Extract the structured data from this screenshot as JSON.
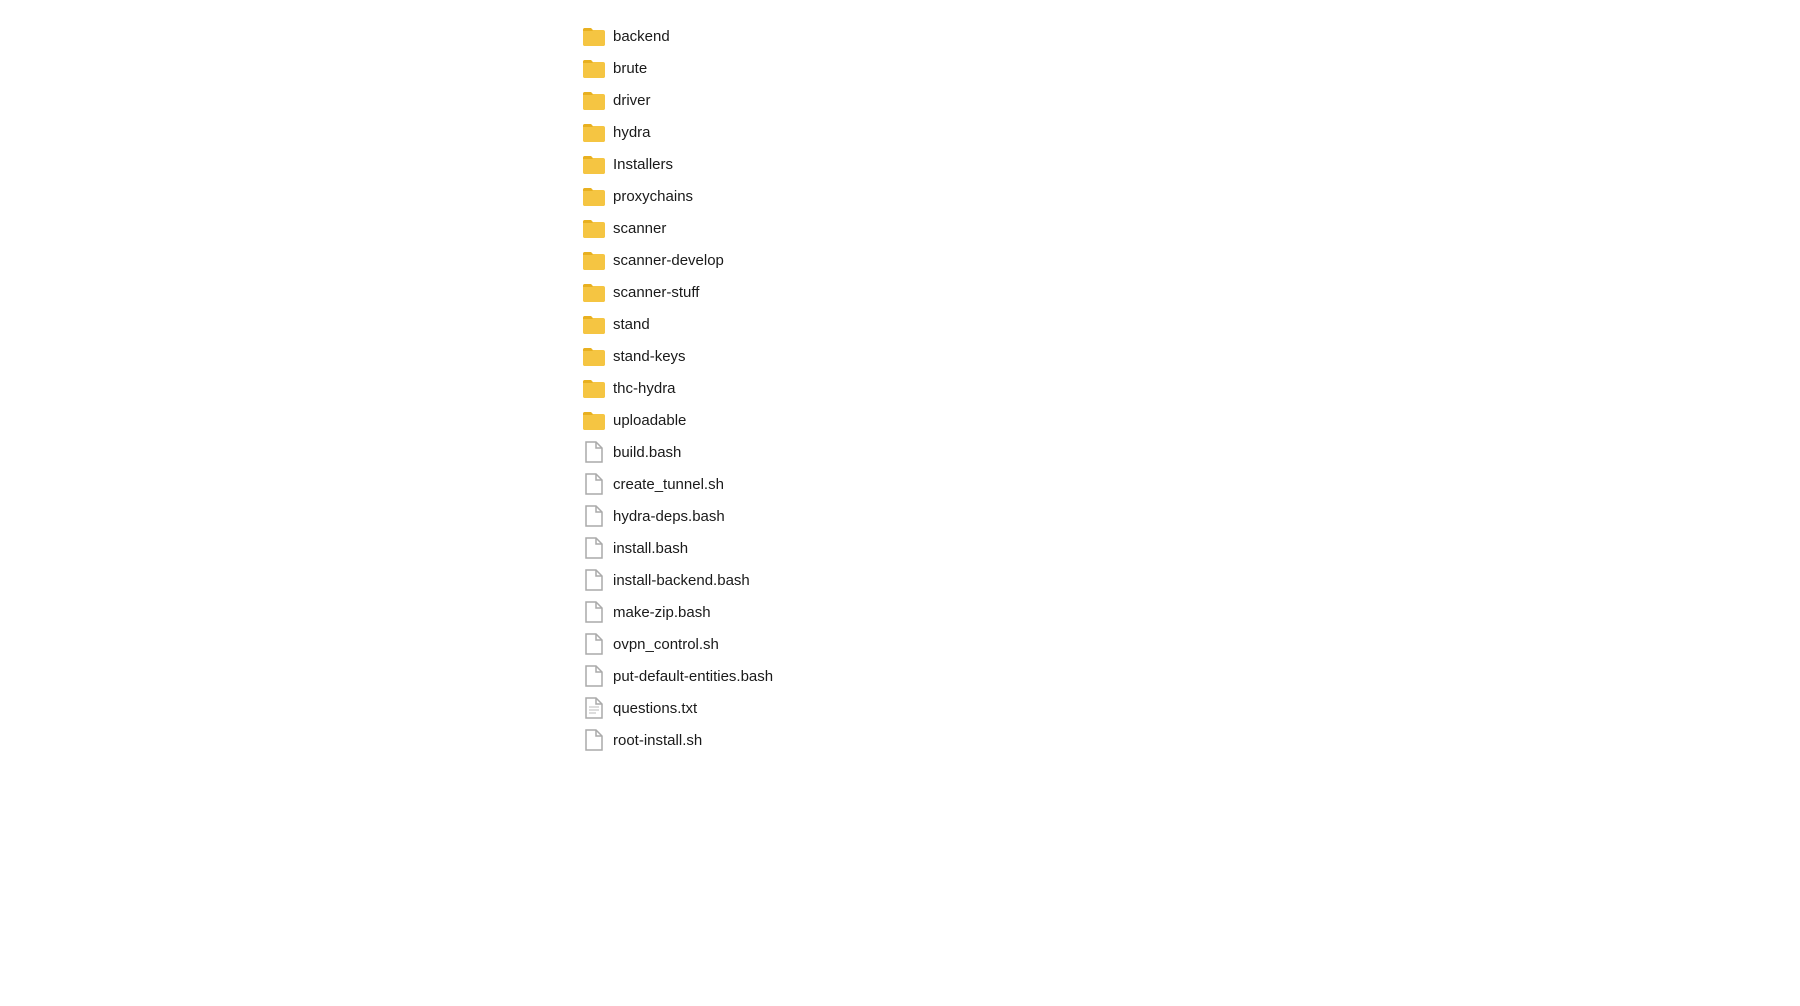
{
  "fileList": {
    "items": [
      {
        "id": "backend",
        "name": "backend",
        "type": "folder"
      },
      {
        "id": "brute",
        "name": "brute",
        "type": "folder"
      },
      {
        "id": "driver",
        "name": "driver",
        "type": "folder"
      },
      {
        "id": "hydra",
        "name": "hydra",
        "type": "folder"
      },
      {
        "id": "Installers",
        "name": "Installers",
        "type": "folder"
      },
      {
        "id": "proxychains",
        "name": "proxychains",
        "type": "folder"
      },
      {
        "id": "scanner",
        "name": "scanner",
        "type": "folder"
      },
      {
        "id": "scanner-develop",
        "name": "scanner-develop",
        "type": "folder"
      },
      {
        "id": "scanner-stuff",
        "name": "scanner-stuff",
        "type": "folder"
      },
      {
        "id": "stand",
        "name": "stand",
        "type": "folder"
      },
      {
        "id": "stand-keys",
        "name": "stand-keys",
        "type": "folder"
      },
      {
        "id": "thc-hydra",
        "name": "thc-hydra",
        "type": "folder"
      },
      {
        "id": "uploadable",
        "name": "uploadable",
        "type": "folder"
      },
      {
        "id": "build.bash",
        "name": "build.bash",
        "type": "file"
      },
      {
        "id": "create_tunnel.sh",
        "name": "create_tunnel.sh",
        "type": "file"
      },
      {
        "id": "hydra-deps.bash",
        "name": "hydra-deps.bash",
        "type": "file"
      },
      {
        "id": "install.bash",
        "name": "install.bash",
        "type": "file"
      },
      {
        "id": "install-backend.bash",
        "name": "install-backend.bash",
        "type": "file"
      },
      {
        "id": "make-zip.bash",
        "name": "make-zip.bash",
        "type": "file"
      },
      {
        "id": "ovpn_control.sh",
        "name": "ovpn_control.sh",
        "type": "file"
      },
      {
        "id": "put-default-entities.bash",
        "name": "put-default-entities.bash",
        "type": "file"
      },
      {
        "id": "questions.txt",
        "name": "questions.txt",
        "type": "file-txt"
      },
      {
        "id": "root-install.sh",
        "name": "root-install.sh",
        "type": "file"
      }
    ]
  },
  "colors": {
    "folderColor": "#f5c542",
    "folderDark": "#e6a817",
    "fileStroke": "#999999",
    "background": "#ffffff",
    "textColor": "#1a1a1a"
  }
}
